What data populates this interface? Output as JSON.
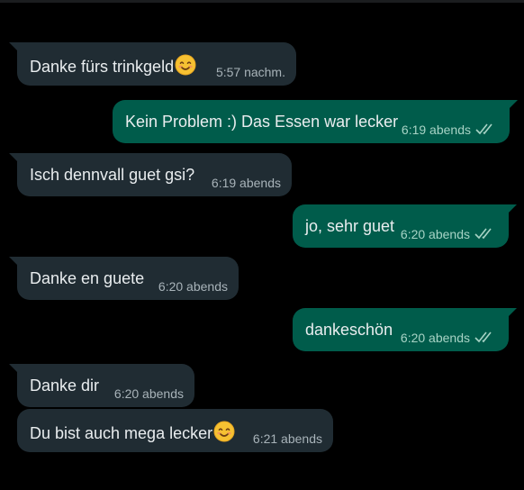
{
  "chat": {
    "messages": [
      {
        "direction": "in",
        "text": "Danke fürs trinkgeld",
        "emoji": "smiling-face-with-smiling-eyes",
        "time": "5:57 nachm."
      },
      {
        "direction": "out",
        "text": "Kein Problem :) Das Essen war lecker",
        "time": "6:19 abends",
        "status": "read"
      },
      {
        "direction": "in",
        "text": "Isch dennvall guet gsi?",
        "time": "6:19 abends"
      },
      {
        "direction": "out",
        "text": "jo, sehr guet",
        "time": "6:20 abends",
        "status": "read"
      },
      {
        "direction": "in",
        "text": "Danke en guete",
        "time": "6:20 abends"
      },
      {
        "direction": "out",
        "text": "dankeschön",
        "time": "6:20 abends",
        "status": "read"
      },
      {
        "direction": "in",
        "text": "Danke dir",
        "time": "6:20 abends"
      },
      {
        "direction": "in",
        "text": "Du bist auch mega lecker",
        "emoji": "smiling-face-with-smiling-eyes",
        "time": "6:21 abends"
      }
    ]
  },
  "colors": {
    "background": "#000000",
    "incoming_bubble": "#202c33",
    "outgoing_bubble": "#005c4b",
    "text": "#e9edef",
    "read_ticks": "#a7d3c5"
  }
}
